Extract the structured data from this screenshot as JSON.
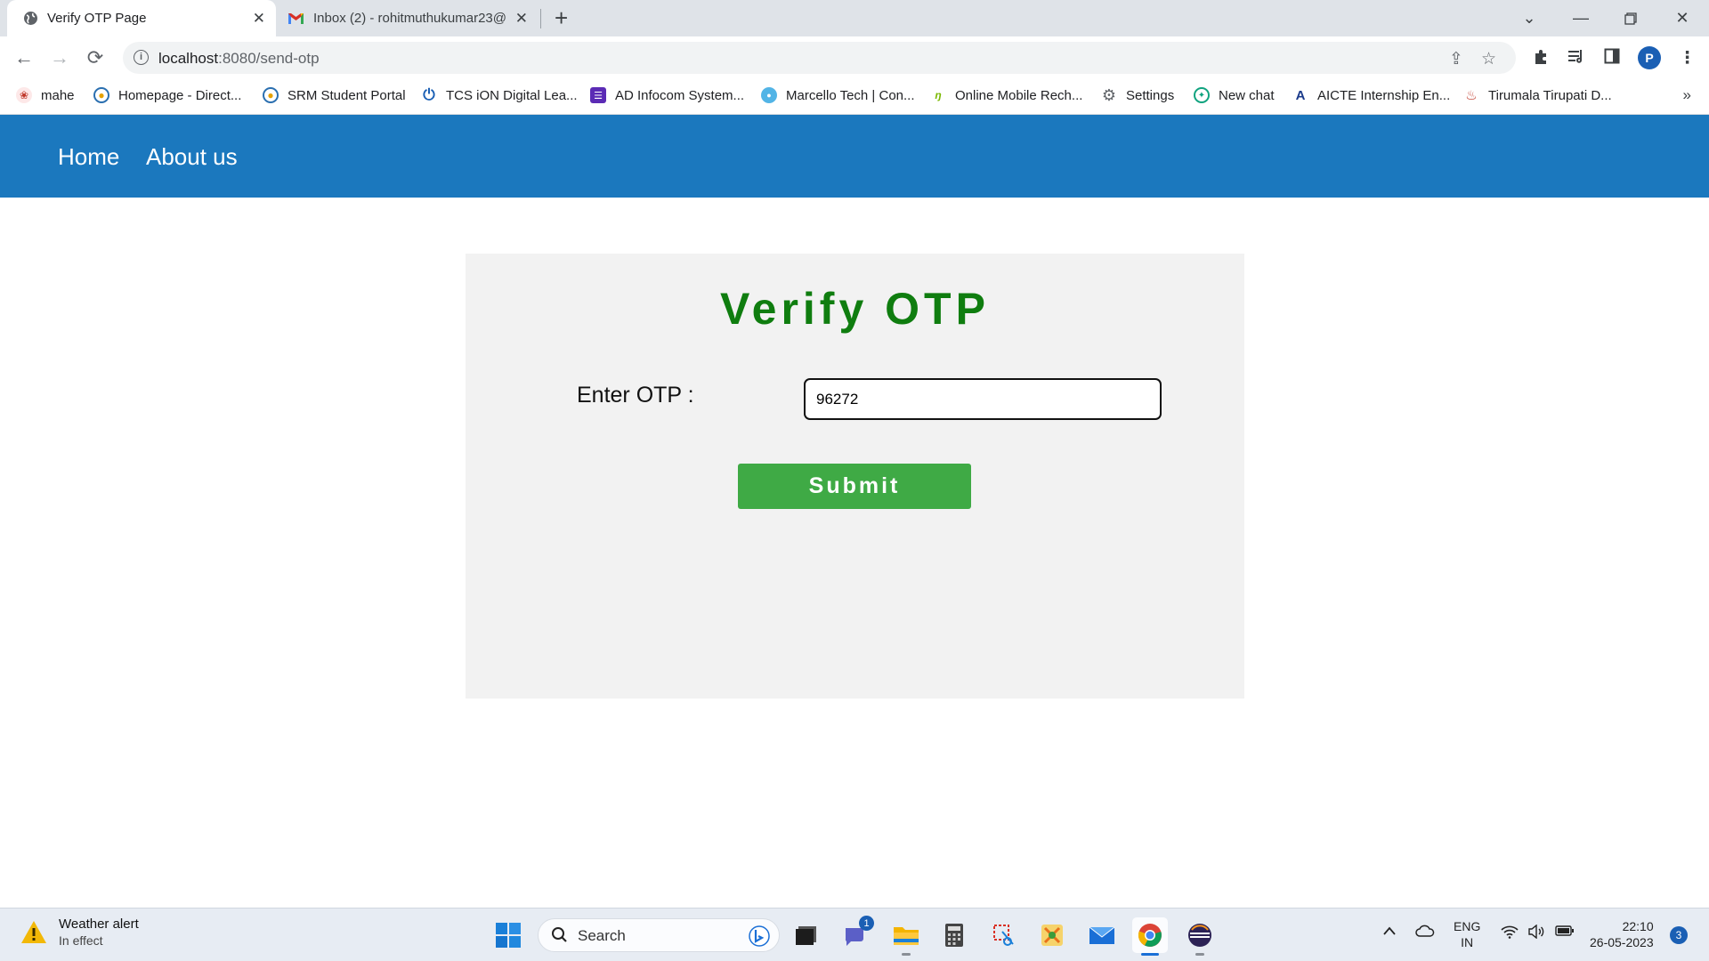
{
  "browser": {
    "tabs": [
      {
        "title": "Verify OTP Page",
        "active": true
      },
      {
        "title": "Inbox (2) - rohitmuthukumar23@",
        "active": false
      }
    ],
    "url_host": "localhost",
    "url_path": ":8080/send-otp",
    "profile_initial": "P",
    "bookmarks": [
      "mahe",
      "Homepage - Direct...",
      "SRM Student Portal",
      "TCS iON Digital Lea...",
      "AD Infocom System...",
      "Marcello Tech | Con...",
      "Online Mobile Rech...",
      "Settings",
      "New chat",
      "AICTE Internship En...",
      "Tirumala Tirupati D..."
    ]
  },
  "nav": {
    "home": "Home",
    "about": "About us"
  },
  "form": {
    "title": "Verify OTP",
    "otp_label": "Enter OTP :",
    "otp_value": "96272",
    "submit_label": "Submit"
  },
  "colors": {
    "nav_bg": "#1b78be",
    "title_green": "#0f7d0f",
    "submit_green": "#3faa45",
    "card_bg": "#f2f2f2"
  },
  "taskbar": {
    "weather_title": "Weather alert",
    "weather_sub": "In effect",
    "search_label": "Search",
    "chat_badge": "1",
    "lang_top": "ENG",
    "lang_bottom": "IN",
    "time": "22:10",
    "date": "26-05-2023",
    "notifications": "3"
  }
}
